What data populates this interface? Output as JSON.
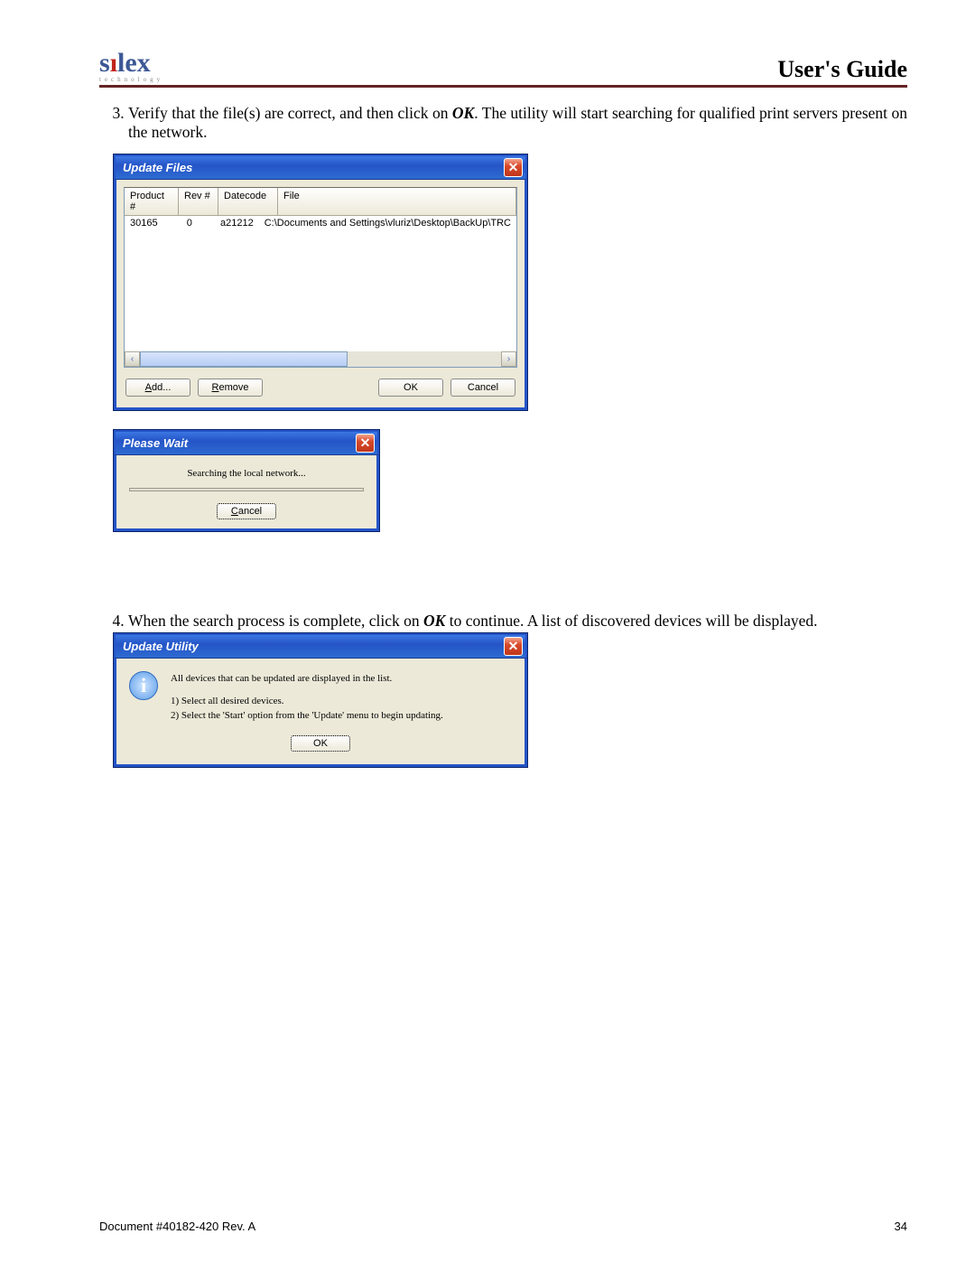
{
  "header": {
    "logo_main": "sılex",
    "logo_sub": "technology",
    "title": "User's Guide"
  },
  "steps": {
    "step3_a": "Verify that the file(s) are correct, and then click on ",
    "step3_ok": "OK",
    "step3_b": ".  The utility will start searching for qualified print servers present on the network.",
    "step4_a": "When the search process is complete, click on ",
    "step4_ok": "OK",
    "step4_b": " to continue.  A list of discovered devices will be displayed."
  },
  "dlg1": {
    "title": "Update Files",
    "cols": {
      "product": "Product #",
      "rev": "Rev #",
      "datecode": "Datecode",
      "file": "File"
    },
    "row": {
      "product": "30165",
      "rev": "0",
      "datecode": "a21212",
      "file": "C:\\Documents and Settings\\vluriz\\Desktop\\BackUp\\TRC"
    },
    "buttons": {
      "add": "Add...",
      "remove": "Remove",
      "ok": "OK",
      "cancel": "Cancel"
    }
  },
  "dlg2": {
    "title": "Please Wait",
    "text": "Searching the local network...",
    "cancel": "Cancel"
  },
  "dlg3": {
    "title": "Update Utility",
    "line1": "All devices that can be updated are displayed in the list.",
    "line2": "1) Select all desired devices.",
    "line3": "2) Select the 'Start' option from the 'Update' menu to begin updating.",
    "ok": "OK"
  },
  "footer": {
    "left": "Document #40182-420  Rev. A",
    "right": "34"
  }
}
